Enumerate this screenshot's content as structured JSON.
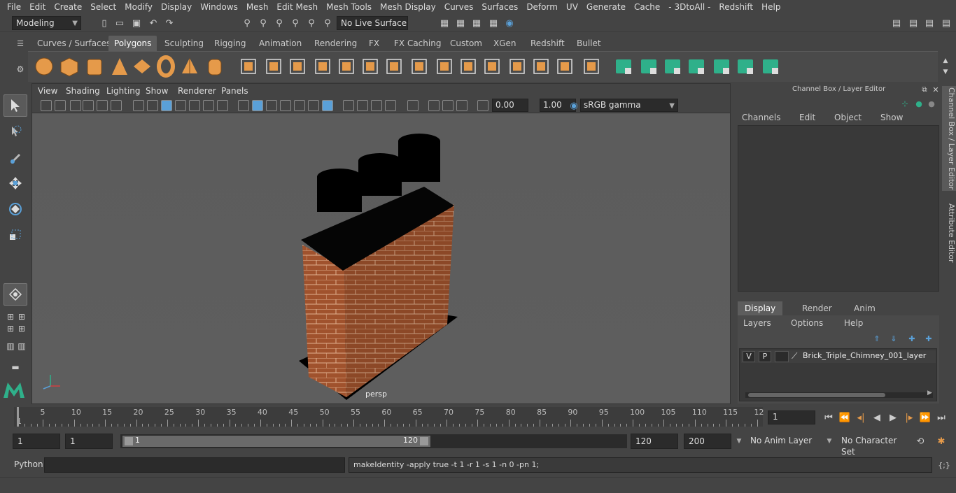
{
  "menubar": {
    "items": [
      "File",
      "Edit",
      "Create",
      "Select",
      "Modify",
      "Display",
      "Windows",
      "Mesh",
      "Edit Mesh",
      "Mesh Tools",
      "Mesh Display",
      "Curves",
      "Surfaces",
      "Deform",
      "UV",
      "Generate",
      "Cache",
      "- 3DtoAll -",
      "Redshift",
      "Help"
    ]
  },
  "status": {
    "mode": "Modeling",
    "live_surface": "No Live Surface"
  },
  "shelf": {
    "tabs": [
      "Curves / Surfaces",
      "Polygons",
      "Sculpting",
      "Rigging",
      "Animation",
      "Rendering",
      "FX",
      "FX Caching",
      "Custom",
      "XGen",
      "Redshift",
      "Bullet"
    ],
    "active": "Polygons"
  },
  "viewport": {
    "menus": [
      "View",
      "Shading",
      "Lighting",
      "Show",
      "Renderer",
      "Panels"
    ],
    "exposure": "0.00",
    "gamma": "1.00",
    "colorspace": "sRGB gamma",
    "camera_label": "persp"
  },
  "panel": {
    "title": "Channel Box / Layer Editor",
    "channel_menus": [
      "Channels",
      "Edit",
      "Object",
      "Show"
    ],
    "layer_tabs": [
      "Display",
      "Render",
      "Anim"
    ],
    "layer_menus": [
      "Layers",
      "Options",
      "Help"
    ],
    "layer": {
      "v": "V",
      "p": "P",
      "name": "Brick_Triple_Chimney_001_layer"
    },
    "side_tabs": [
      "Channel Box / Layer Editor",
      "Attribute Editor"
    ]
  },
  "timeline": {
    "ticks": [
      "5",
      "10",
      "15",
      "20",
      "25",
      "30",
      "35",
      "40",
      "45",
      "50",
      "55",
      "60",
      "65",
      "70",
      "75",
      "80",
      "85",
      "90",
      "95",
      "100",
      "105",
      "110",
      "115",
      "12"
    ],
    "start_marker": "1",
    "current_frame": "1"
  },
  "range": {
    "start": "1",
    "playback_start": "1",
    "slider_start": "1",
    "slider_end": "120",
    "playback_end": "120",
    "end": "200",
    "anim_layer": "No Anim Layer",
    "character_set": "No Character Set"
  },
  "cmdline": {
    "lang": "Python",
    "output": "makeIdentity -apply true -t 1 -r 1 -s 1 -n 0 -pn 1;"
  },
  "colors": {
    "brick": "#a0522d",
    "shelf_orange": "#e59a4a",
    "shelf_green": "#2fb08a",
    "accent_blue": "#5aa0d8"
  }
}
